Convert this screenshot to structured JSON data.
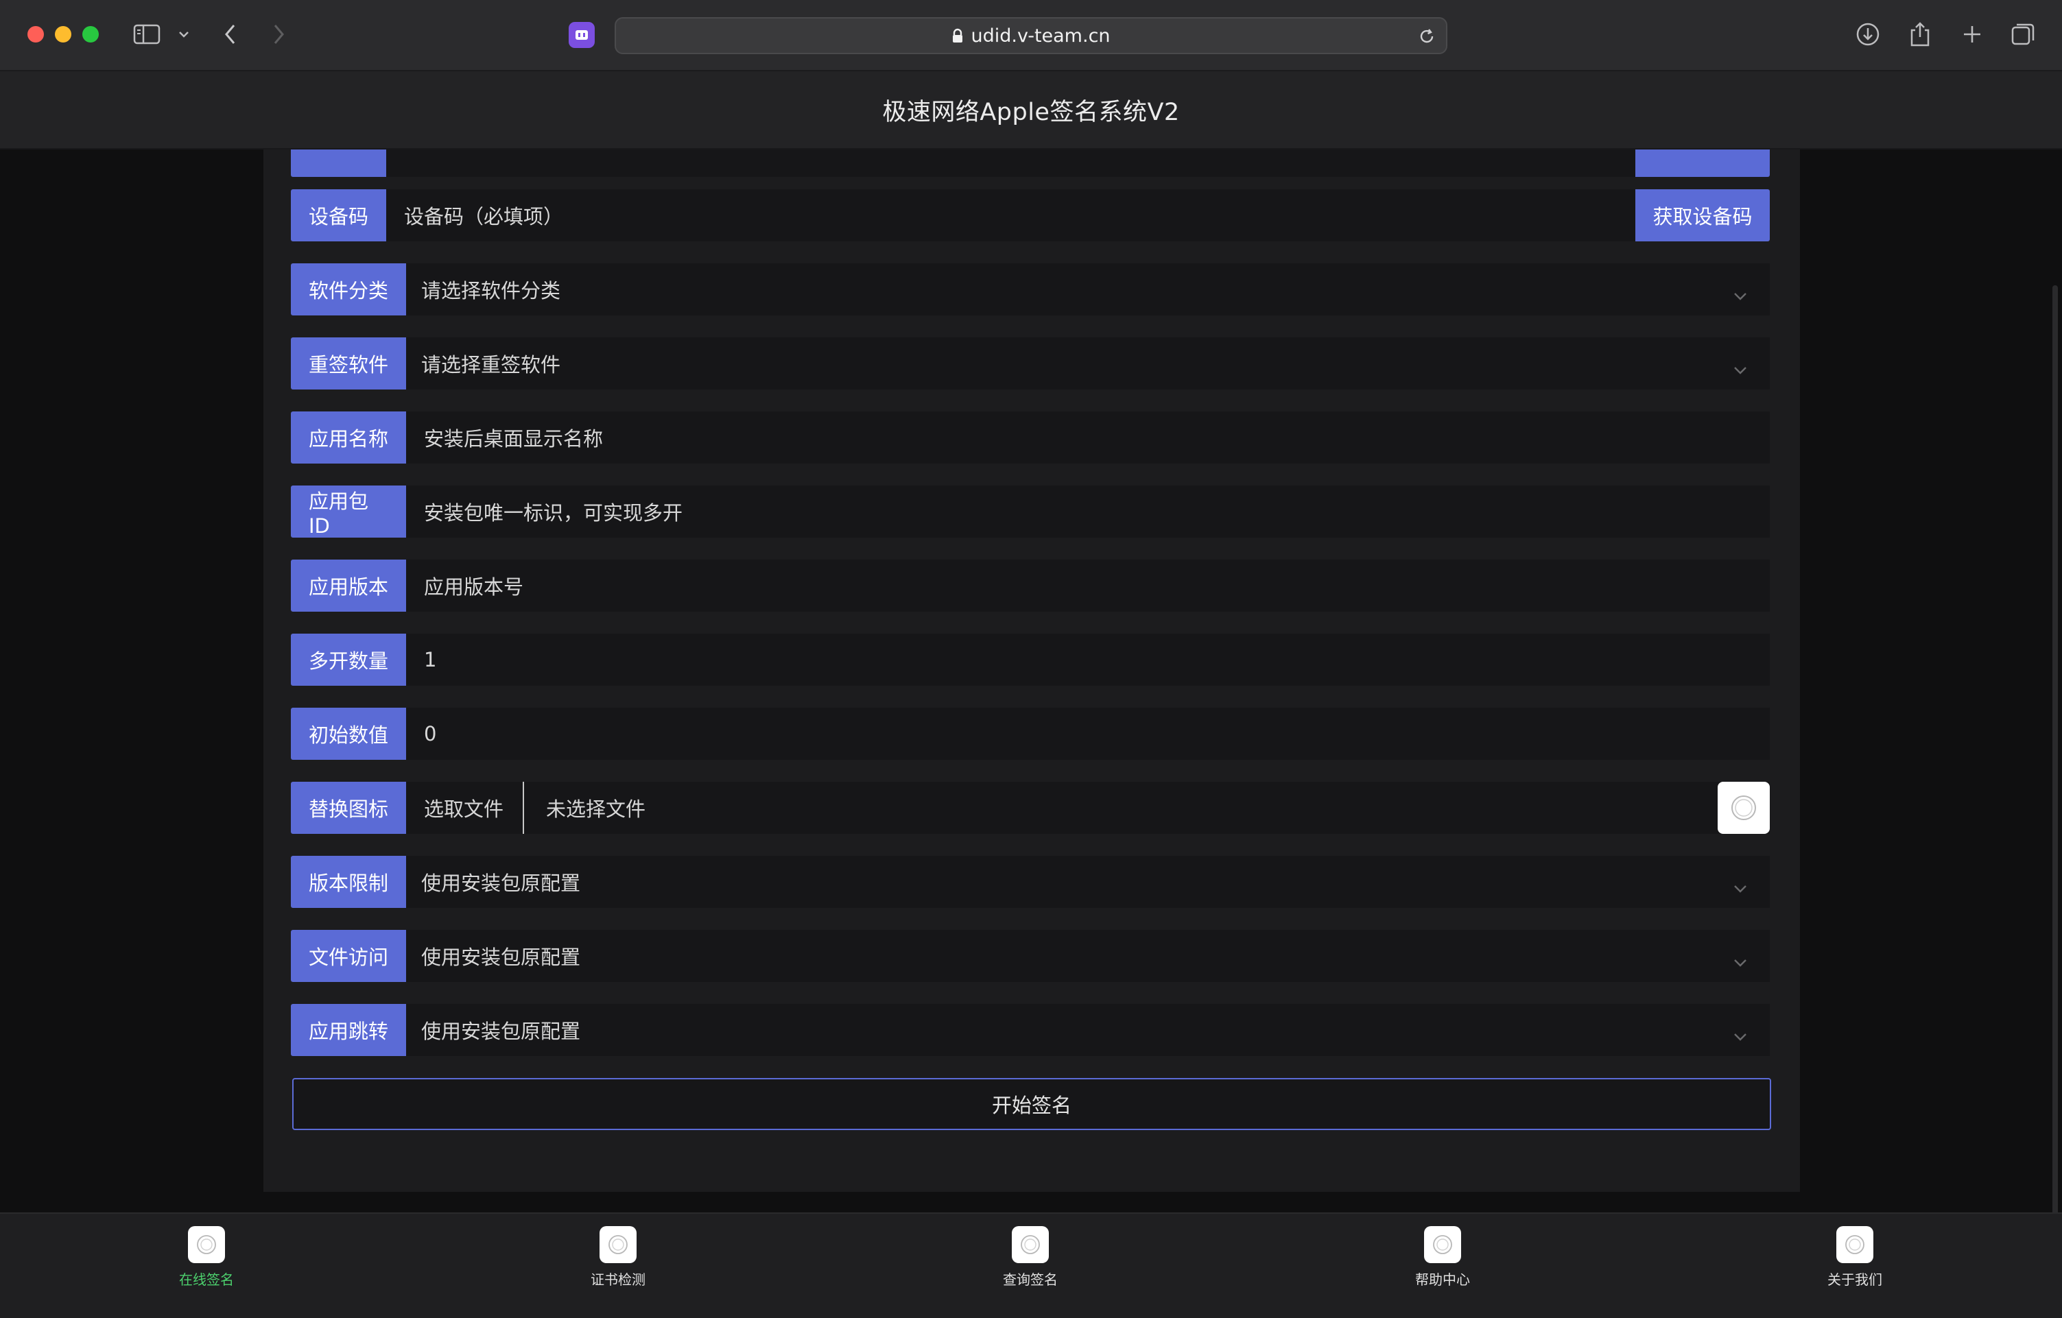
{
  "browser": {
    "url": "udid.v-team.cn"
  },
  "site": {
    "title": "极速网络Apple签名系统V2"
  },
  "form": {
    "device_code": {
      "label": "设备码",
      "placeholder": "设备码（必填项）",
      "button": "获取设备码"
    },
    "category": {
      "label": "软件分类",
      "value": "请选择软件分类"
    },
    "resign_app": {
      "label": "重签软件",
      "value": "请选择重签软件"
    },
    "app_name": {
      "label": "应用名称",
      "placeholder": "安装后桌面显示名称"
    },
    "bundle_id": {
      "label": "应用包ID",
      "placeholder": "安装包唯一标识，可实现多开"
    },
    "app_version": {
      "label": "应用版本",
      "placeholder": "应用版本号"
    },
    "multi_count": {
      "label": "多开数量",
      "value": "1"
    },
    "initial_value": {
      "label": "初始数值",
      "value": "0"
    },
    "replace_icon": {
      "label": "替换图标",
      "choose": "选取文件",
      "status": "未选择文件"
    },
    "version_limit": {
      "label": "版本限制",
      "value": "使用安装包原配置"
    },
    "file_access": {
      "label": "文件访问",
      "value": "使用安装包原配置"
    },
    "app_jump": {
      "label": "应用跳转",
      "value": "使用安装包原配置"
    },
    "submit": "开始签名"
  },
  "tabbar": {
    "items": [
      {
        "label": "在线签名",
        "active": true
      },
      {
        "label": "证书检测",
        "active": false
      },
      {
        "label": "查询签名",
        "active": false
      },
      {
        "label": "帮助中心",
        "active": false
      },
      {
        "label": "关于我们",
        "active": false
      }
    ]
  },
  "colors": {
    "accent": "#5b6bd6",
    "active_tab": "#4cd06d",
    "background": "#0f0f10"
  }
}
